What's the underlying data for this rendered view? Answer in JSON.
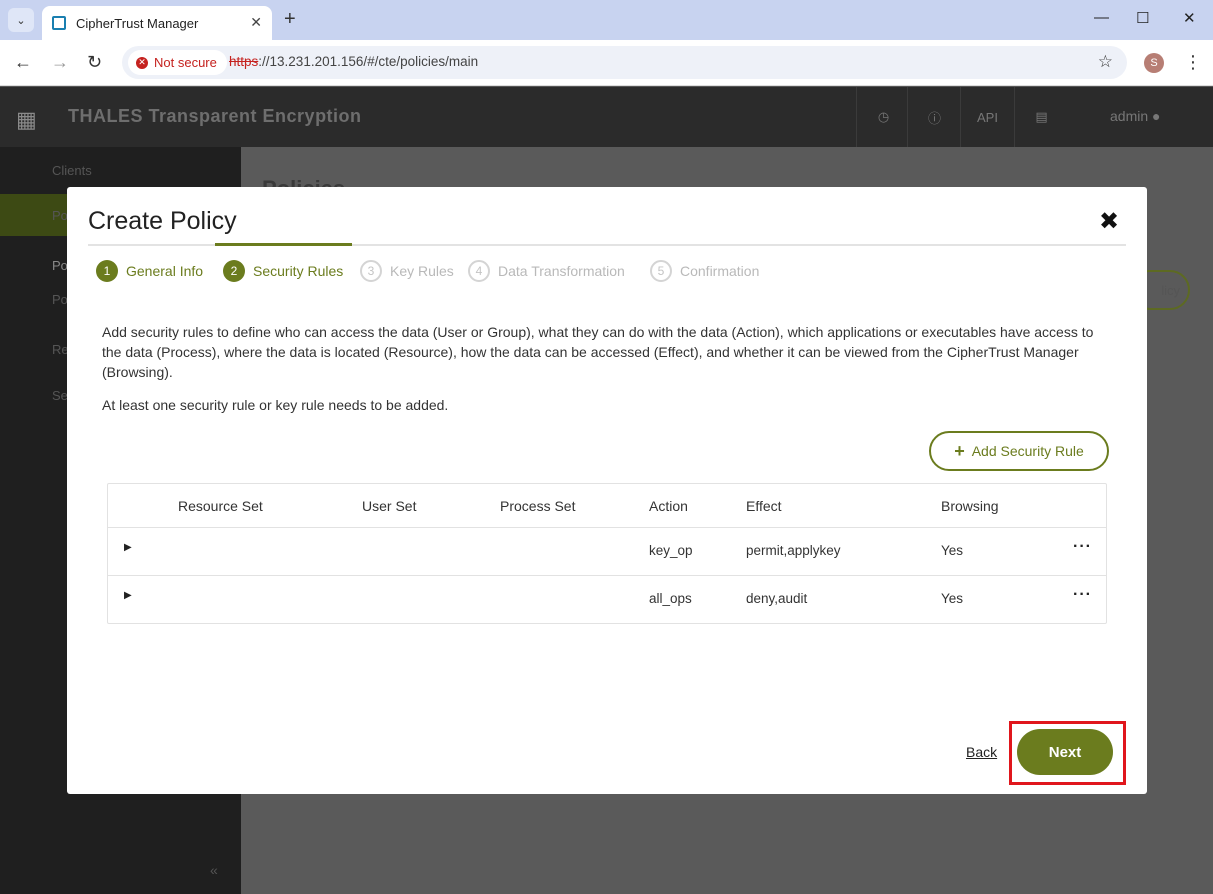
{
  "browser": {
    "tab_title": "CipherTrust Manager",
    "tab_close": "✕",
    "new_tab": "+",
    "tab_menu": "⌄",
    "window_minimize": "—",
    "window_maximize": "☐",
    "window_close": "✕",
    "back": "←",
    "forward": "→",
    "reload": "↻",
    "security_label": "Not secure",
    "url_scheme": "https",
    "url_rest": "://13.231.201.156/#/cte/policies/main",
    "profile_initial": "S"
  },
  "app": {
    "title": "THALES Transparent Encryption",
    "header_buttons": [
      "◷",
      "ⓘ",
      "API",
      "▤"
    ],
    "user": "admin",
    "sidebar_items": [
      "Clients",
      "Po",
      "Po",
      "Po",
      "Re",
      "Se"
    ],
    "page_title": "Policies",
    "ghost_button": "licy",
    "collapse": "«"
  },
  "modal": {
    "title": "Create Policy",
    "close": "✖",
    "steps": [
      {
        "num": "1",
        "label": "General Info",
        "state": "done"
      },
      {
        "num": "2",
        "label": "Security Rules",
        "state": "active"
      },
      {
        "num": "3",
        "label": "Key Rules",
        "state": "pending"
      },
      {
        "num": "4",
        "label": "Data Transformation",
        "state": "pending"
      },
      {
        "num": "5",
        "label": "Confirmation",
        "state": "pending"
      }
    ],
    "description": "Add security rules to define who can access the data (User or Group), what they can do with the data (Action), which applications or executables have access to the data (Process), where the data is located (Resource), how the data can be accessed (Effect), and whether it can be viewed from the CipherTrust Manager (Browsing).",
    "note": "At least one security rule or key rule needs to be added.",
    "add_rule_label": "Add Security Rule",
    "table": {
      "headers": [
        "Resource Set",
        "User Set",
        "Process Set",
        "Action",
        "Effect",
        "Browsing"
      ],
      "rows": [
        {
          "resource": "",
          "user": "",
          "process": "",
          "action": "key_op",
          "effect": "permit,applykey",
          "browsing": "Yes"
        },
        {
          "resource": "",
          "user": "",
          "process": "",
          "action": "all_ops",
          "effect": "deny,audit",
          "browsing": "Yes"
        }
      ]
    },
    "back_label": "Back",
    "next_label": "Next"
  },
  "colors": {
    "accent": "#6b7c1e",
    "highlight": "#e0161c",
    "danger": "#c5221f"
  }
}
